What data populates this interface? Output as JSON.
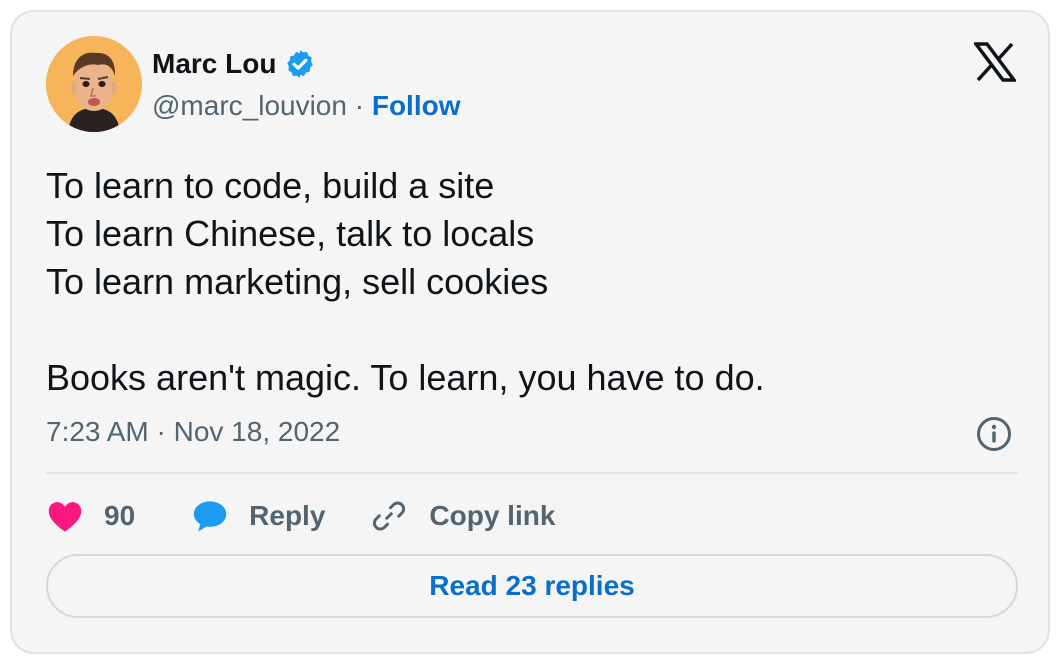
{
  "author": {
    "name": "Marc Lou",
    "handle": "@marc_louvion",
    "separator": "·",
    "follow_label": "Follow"
  },
  "tweet": {
    "lines": [
      "To learn to code, build a site",
      "To learn Chinese, talk to locals",
      "To learn marketing, sell cookies",
      "",
      "Books aren't magic. To learn, you have to do."
    ],
    "timestamp": "7:23 AM · Nov 18, 2022"
  },
  "actions": {
    "like_count": "90",
    "reply_label": "Reply",
    "copy_link_label": "Copy link"
  },
  "read_replies_label": "Read 23 replies",
  "icons": {
    "verified": "verified-badge-icon",
    "brand": "x-logo-icon",
    "info": "info-icon",
    "like": "heart-icon",
    "reply": "speech-bubble-icon",
    "copy": "link-icon"
  },
  "colors": {
    "card_background": "#f5f5f5",
    "accent_blue": "#0a6ecb",
    "verified_blue": "#1d9bf0",
    "like_pink": "#f91880",
    "muted_text": "#536471",
    "primary_text": "#0f1419"
  }
}
